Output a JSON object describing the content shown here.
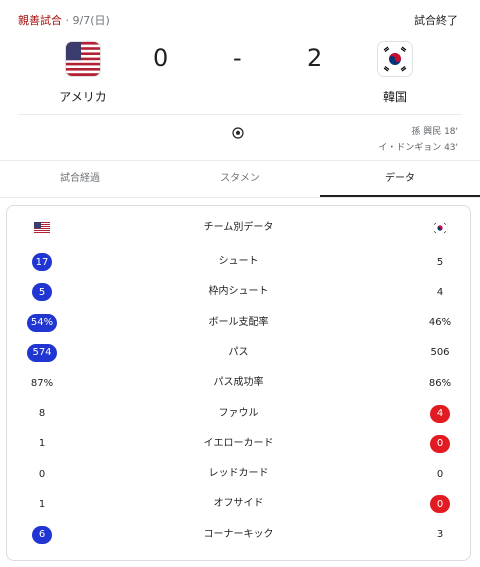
{
  "header": {
    "match_type": "親善試合",
    "match_date": " · 9/7(日)",
    "status": "試合終了"
  },
  "teams": {
    "home": {
      "name": "アメリカ",
      "score": "0",
      "flag_icon": "usa-flag-icon"
    },
    "away": {
      "name": "韓国",
      "score": "2",
      "flag_icon": "korea-flag-icon"
    },
    "separator": "-"
  },
  "goals": {
    "away": [
      "孫 興民 18'",
      "イ・ドンギョン 43'"
    ]
  },
  "tabs": [
    {
      "label": "試合経過",
      "active": false
    },
    {
      "label": "スタメン",
      "active": false
    },
    {
      "label": "データ",
      "active": true
    }
  ],
  "stats": {
    "title": "チーム別データ",
    "rows": [
      {
        "label": "シュート",
        "home": "17",
        "away": "5",
        "home_hl": "blue",
        "away_hl": ""
      },
      {
        "label": "枠内シュート",
        "home": "5",
        "away": "4",
        "home_hl": "blue",
        "away_hl": ""
      },
      {
        "label": "ボール支配率",
        "home": "54%",
        "away": "46%",
        "home_hl": "blue",
        "away_hl": ""
      },
      {
        "label": "パス",
        "home": "574",
        "away": "506",
        "home_hl": "blue",
        "away_hl": ""
      },
      {
        "label": "パス成功率",
        "home": "87%",
        "away": "86%",
        "home_hl": "",
        "away_hl": ""
      },
      {
        "label": "ファウル",
        "home": "8",
        "away": "4",
        "home_hl": "",
        "away_hl": "red"
      },
      {
        "label": "イエローカード",
        "home": "1",
        "away": "0",
        "home_hl": "",
        "away_hl": "red"
      },
      {
        "label": "レッドカード",
        "home": "0",
        "away": "0",
        "home_hl": "",
        "away_hl": ""
      },
      {
        "label": "オフサイド",
        "home": "1",
        "away": "0",
        "home_hl": "",
        "away_hl": "red"
      },
      {
        "label": "コーナーキック",
        "home": "6",
        "away": "3",
        "home_hl": "blue",
        "away_hl": ""
      }
    ]
  },
  "colors": {
    "accent_blue": "#2035d1",
    "accent_red": "#e21b23",
    "match_type": "#a50e0e"
  }
}
